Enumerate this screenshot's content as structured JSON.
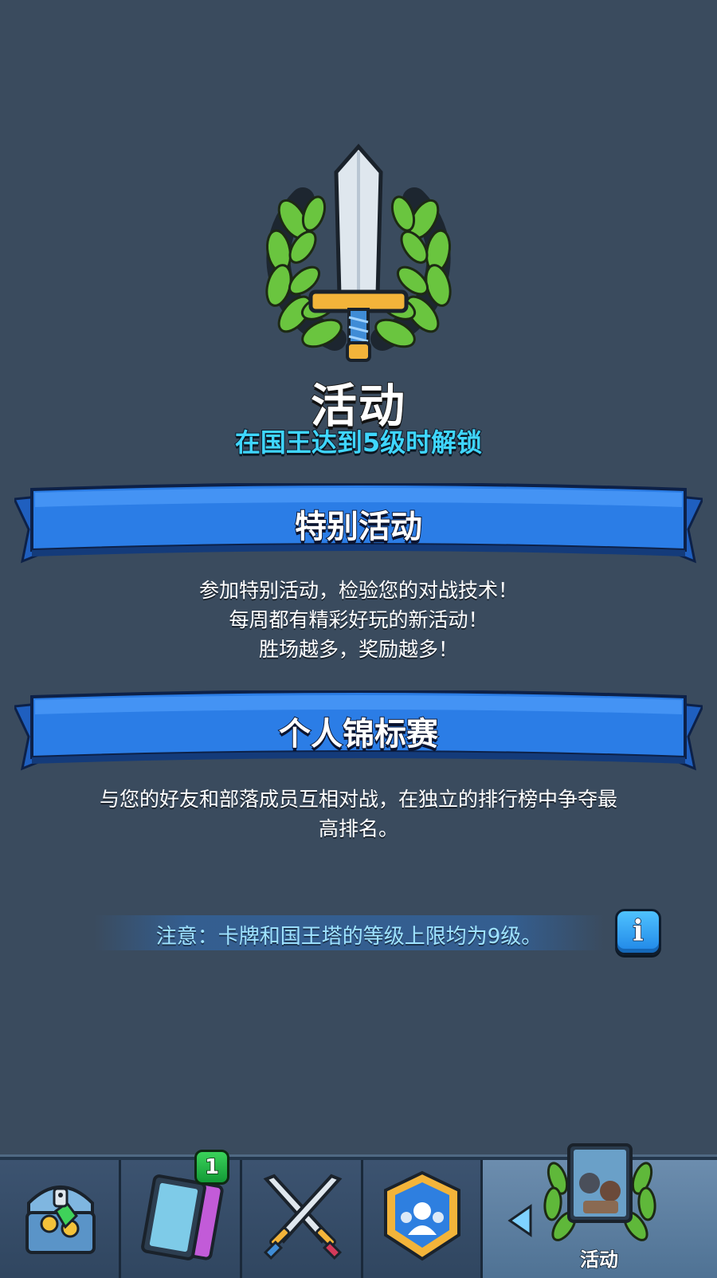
{
  "header": {
    "title": "活动",
    "unlock_text": "在国王达到5级时解锁",
    "emblem_icon": "sword-laurel-icon"
  },
  "sections": [
    {
      "title": "特别活动",
      "lines": [
        "参加特别活动，检验您的对战技术！",
        "每周都有精彩好玩的新活动！",
        "胜场越多，奖励越多！"
      ]
    },
    {
      "title": "个人锦标赛",
      "lines": [
        "与您的好友和部落成员互相对战，在独立的排行榜中争夺最",
        "高排名。"
      ]
    }
  ],
  "note": {
    "text": "注意：卡牌和国王塔的等级上限均为9级。",
    "info_glyph": "i"
  },
  "bottom_nav": {
    "cards_badge": "1",
    "active_tab_label": "活动",
    "tabs": [
      {
        "icon": "treasure-chest-icon"
      },
      {
        "icon": "cards-icon"
      },
      {
        "icon": "crossed-swords-icon"
      },
      {
        "icon": "clan-shield-icon"
      },
      {
        "icon": "events-laurel-icon",
        "label": "活动"
      }
    ]
  },
  "colors": {
    "background": "#3a4b5e",
    "accent_cyan": "#3fd6ff",
    "ribbon_blue": "#2b7de6",
    "note_text": "#9fe3ff",
    "badge_green": "#1fb847"
  }
}
